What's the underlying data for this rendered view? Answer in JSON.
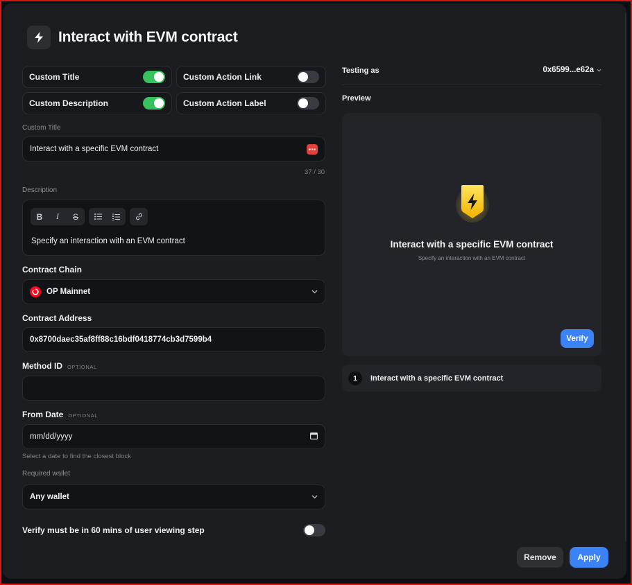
{
  "header": {
    "title": "Interact with EVM contract",
    "icon": "lightning-icon"
  },
  "toggles": [
    {
      "label": "Custom Title",
      "on": true
    },
    {
      "label": "Custom Action Link",
      "on": false
    },
    {
      "label": "Custom Description",
      "on": true
    },
    {
      "label": "Custom Action Label",
      "on": false
    }
  ],
  "custom_title": {
    "label": "Custom Title",
    "value": "Interact with a specific EVM contract",
    "counter": "37 / 30",
    "error_color": "#e0413a"
  },
  "description": {
    "label": "Description",
    "toolbar": [
      "bold-icon",
      "italic-icon",
      "strikethrough-icon",
      "bullet-list-icon",
      "numbered-list-icon",
      "link-icon"
    ],
    "value": "Specify an interaction with an EVM contract"
  },
  "contract_chain": {
    "label": "Contract Chain",
    "value": "OP Mainnet",
    "icon": "optimism-icon"
  },
  "contract_address": {
    "label": "Contract Address",
    "value": "0x8700daec35af8ff88c16bdf0418774cb3d7599b4"
  },
  "method_id": {
    "label": "Method ID",
    "tag": "OPTIONAL",
    "value": ""
  },
  "from_date": {
    "label": "From Date",
    "tag": "OPTIONAL",
    "placeholder": "mm/dd/yyyy",
    "helper": "Select a date to find the closest block"
  },
  "required_wallet": {
    "label": "Required wallet",
    "value": "Any wallet"
  },
  "verify_window": {
    "label": "Verify must be in 60 mins of user viewing step",
    "on": false
  },
  "right": {
    "testing_as_label": "Testing as",
    "wallet_address": "0x6599...e62a",
    "preview_label": "Preview",
    "preview_title": "Interact with a specific EVM contract",
    "preview_subtitle": "Specify an interaction with an EVM contract",
    "verify_label": "Verify",
    "step_number": "1",
    "step_text": "Interact with a specific EVM contract"
  },
  "footer": {
    "remove_label": "Remove",
    "apply_label": "Apply"
  },
  "colors": {
    "accent": "#3b82f6",
    "toggle_on": "#38c25e",
    "background": "#1c1d21",
    "badge": "#f5c518"
  }
}
